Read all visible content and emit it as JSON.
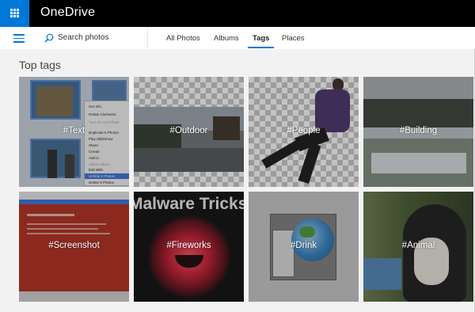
{
  "app": {
    "title": "OneDrive",
    "brand_color": "#0078d7"
  },
  "search": {
    "placeholder": "Search photos"
  },
  "tabs": [
    {
      "label": "All Photos"
    },
    {
      "label": "Albums"
    },
    {
      "label": "Tags",
      "active": true
    },
    {
      "label": "Places"
    }
  ],
  "section": {
    "title": "Top tags"
  },
  "tags": [
    {
      "label": "#Text"
    },
    {
      "label": "#Outdoor"
    },
    {
      "label": "#People"
    },
    {
      "label": "#Building"
    },
    {
      "label": "#Screenshot"
    },
    {
      "label": "#Fireworks"
    },
    {
      "label": "#Drink"
    },
    {
      "label": "#Animal"
    }
  ],
  "text_tile": {
    "menu": [
      "Get Info",
      "Rotate Clockwise",
      "Turn On Live Photo",
      "Duplicate 5 Photos",
      "Play Slideshow",
      "Share",
      "Create",
      "Add to",
      "Add to Album",
      "Edit With",
      "Unhide 5 Photos",
      "Delete 5 Photos"
    ]
  },
  "fireworks_tile": {
    "banner": "Malware Tricks"
  },
  "icons": [
    "app-launcher-icon",
    "hamburger-menu-icon",
    "search-icon"
  ]
}
